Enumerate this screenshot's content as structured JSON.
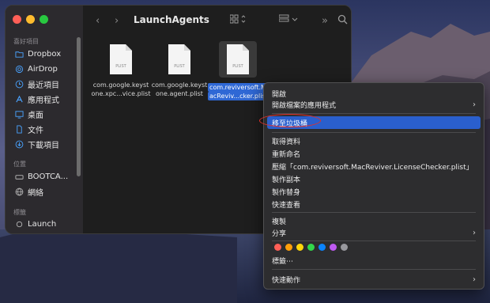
{
  "window": {
    "title": "LaunchAgents",
    "toolbar_icons": [
      "back-icon",
      "forward-icon",
      "grid-view-icon",
      "group-icon",
      "more-icon",
      "search-icon"
    ]
  },
  "sidebar": {
    "favorites_header": "喜好項目",
    "favorites": [
      {
        "label": "Dropbox",
        "icon": "folder-icon"
      },
      {
        "label": "AirDrop",
        "icon": "airdrop-icon"
      },
      {
        "label": "最近項目",
        "icon": "clock-icon"
      },
      {
        "label": "應用程式",
        "icon": "applications-icon"
      },
      {
        "label": "桌面",
        "icon": "desktop-icon"
      },
      {
        "label": "文件",
        "icon": "document-icon"
      },
      {
        "label": "下載項目",
        "icon": "download-icon"
      }
    ],
    "locations_header": "位置",
    "locations": [
      {
        "label": "BOOTCA...",
        "icon": "drive-icon"
      },
      {
        "label": "網絡",
        "icon": "network-icon"
      }
    ],
    "tags_header": "標籤",
    "tags": [
      {
        "label": "Launch",
        "icon": "tag-circle-icon"
      }
    ]
  },
  "files": [
    {
      "badge": "PLIST",
      "line1": "com.google.keyst",
      "line2": "one.xpc...vice.plist",
      "selected": false
    },
    {
      "badge": "PLIST",
      "line1": "com.google.keyst",
      "line2": "one.agent.plist",
      "selected": false
    },
    {
      "badge": "PLIST",
      "line1": "com.reviversoft.M",
      "line2": "acReviv...cker.plist",
      "selected": true
    }
  ],
  "context_menu": {
    "open": "開啟",
    "open_with": "開啟檔案的應用程式",
    "move_to_trash": "移至垃圾桶",
    "get_info": "取得資料",
    "rename": "重新命名",
    "compress": "壓縮「com.reviversoft.MacReviver.LicenseChecker.plist」",
    "duplicate": "製作副本",
    "make_alias": "製作替身",
    "quick_look": "快速查看",
    "copy": "複製",
    "share": "分享",
    "tags": "標籤⋯",
    "quick_actions": "快速動作",
    "tag_colors": [
      "#ff5f57",
      "#ff9f0a",
      "#ffd60a",
      "#32d74b",
      "#0a84ff",
      "#bf5af2",
      "#98989d"
    ]
  }
}
